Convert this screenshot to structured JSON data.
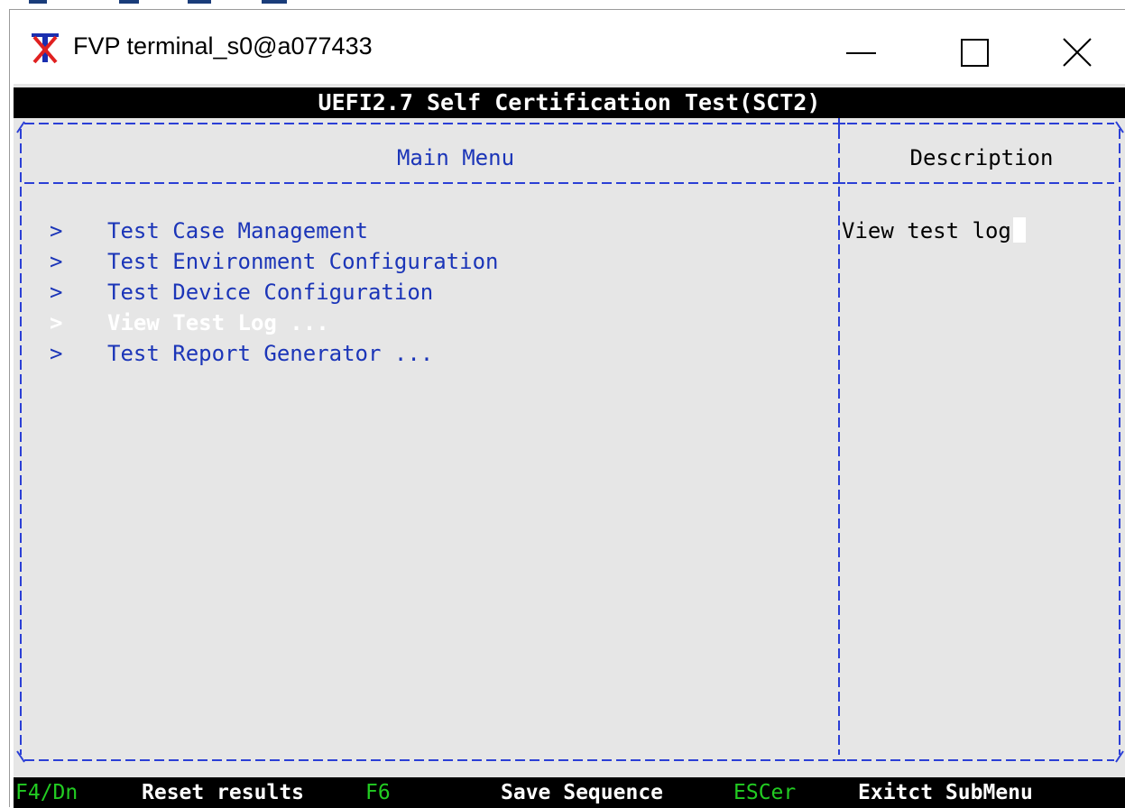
{
  "window": {
    "title": "FVP terminal_s0@a077433",
    "icon": "terminal-x-icon"
  },
  "controls": {
    "minimize": "minimize-icon",
    "maximize": "maximize-icon",
    "close": "close-icon"
  },
  "terminal": {
    "header": "UEFI2.7 Self Certification Test(SCT2)",
    "main_title": "Main Menu",
    "desc_title": "Description",
    "arrow": ">",
    "menu_items": [
      "Test Case Management",
      "Test Environment Configuration",
      "Test Device Configuration",
      "View Test Log ...",
      "Test Report Generator ..."
    ],
    "selected_index": 3,
    "description": "View test log",
    "footer": [
      {
        "key": "F4/Dn",
        "label": "Reset results"
      },
      {
        "key": "F6",
        "label": "Save Sequence"
      },
      {
        "key": "ESCer",
        "label": "Exitct SubMenu"
      }
    ]
  },
  "colors": {
    "menu_text": "#1b35b8",
    "selected_text": "#ffffff",
    "terminal_bg": "#e6e6e6",
    "footer_key": "#22cc22"
  }
}
